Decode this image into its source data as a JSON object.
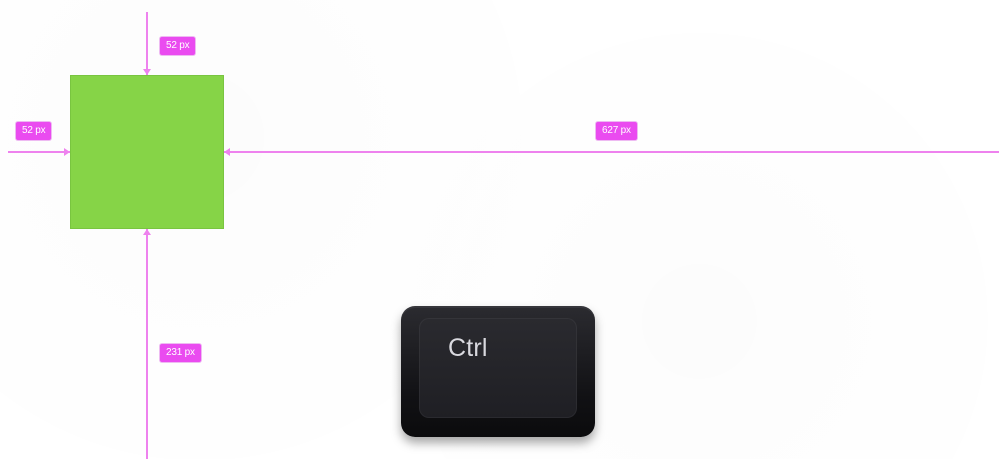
{
  "measurements": {
    "top_offset": "52 px",
    "left_offset": "52 px",
    "right_offset": "627 px",
    "bottom_offset": "231 px"
  },
  "key": {
    "label": "Ctrl"
  },
  "colors": {
    "guide": "#ee82ee",
    "badge": "#ea4bf0",
    "square": "#86d447",
    "key": "#111114"
  }
}
